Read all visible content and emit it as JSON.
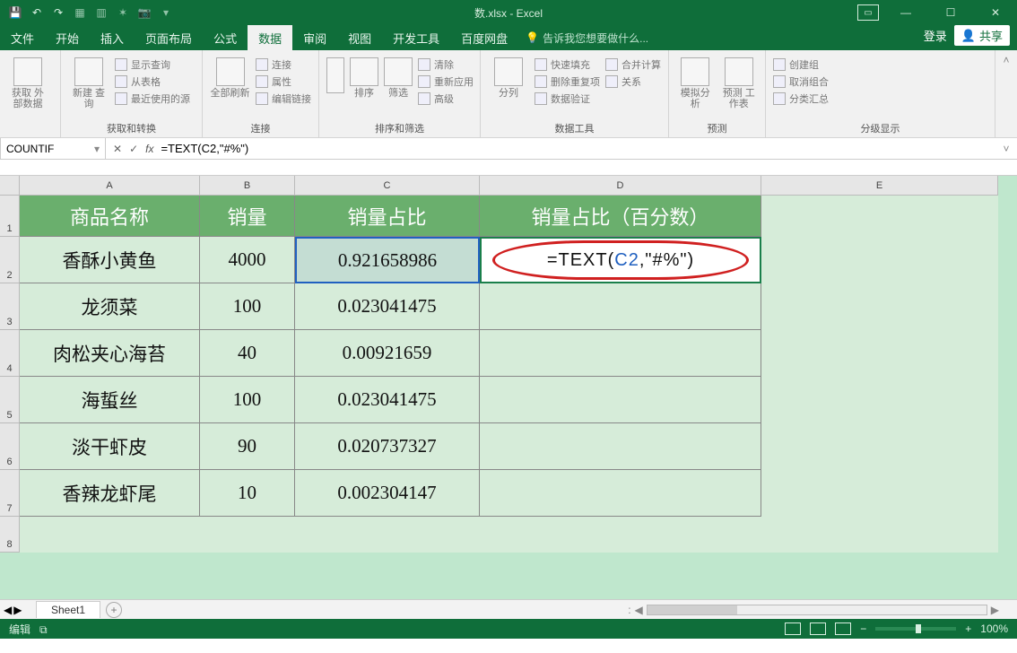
{
  "app": {
    "title": "数.xlsx - Excel"
  },
  "qat": [
    "save-icon",
    "undo-icon",
    "redo-icon",
    "q4",
    "q5",
    "q6",
    "q7"
  ],
  "tabs": {
    "file": "文件",
    "items": [
      "开始",
      "插入",
      "页面布局",
      "公式",
      "数据",
      "审阅",
      "视图",
      "开发工具",
      "百度网盘"
    ],
    "active": "数据",
    "tellme": "告诉我您想要做什么...",
    "login": "登录",
    "share": "共享"
  },
  "ribbon": {
    "g1": {
      "big": "获取\n外部数据",
      "label": ""
    },
    "g2": {
      "big": "新建\n查询",
      "s1": "显示查询",
      "s2": "从表格",
      "s3": "最近使用的源",
      "label": "获取和转换"
    },
    "g3": {
      "big": "全部刷新",
      "s1": "连接",
      "s2": "属性",
      "s3": "编辑链接",
      "label": "连接"
    },
    "g4": {
      "b1": "↓A\nZ",
      "b2": "排序",
      "b3": "筛选",
      "s1": "清除",
      "s2": "重新应用",
      "s3": "高级",
      "label": "排序和筛选"
    },
    "g5": {
      "big": "分列",
      "s1": "快速填充",
      "s2": "删除重复项",
      "s3": "数据验证",
      "s4": "合并计算",
      "s5": "关系",
      "label": "数据工具"
    },
    "g6": {
      "b1": "模拟分析",
      "b2": "预测\n工作表",
      "label": "预测"
    },
    "g7": {
      "s1": "创建组",
      "s2": "取消组合",
      "s3": "分类汇总",
      "label": "分级显示"
    }
  },
  "namebox": {
    "value": "COUNTIF"
  },
  "formulabar": {
    "value": "=TEXT(C2,\"#%\")"
  },
  "columns": {
    "A": "A",
    "B": "B",
    "C": "C",
    "D": "D",
    "E": "E"
  },
  "headers": {
    "A": "商品名称",
    "B": "销量",
    "C": "销量占比",
    "D": "销量占比（百分数）"
  },
  "rows": [
    {
      "A": "香酥小黄鱼",
      "B": "4000",
      "C": "0.921658986"
    },
    {
      "A": "龙须菜",
      "B": "100",
      "C": "0.023041475"
    },
    {
      "A": "肉松夹心海苔",
      "B": "40",
      "C": "0.00921659"
    },
    {
      "A": "海蜇丝",
      "B": "100",
      "C": "0.023041475"
    },
    {
      "A": "淡干虾皮",
      "B": "90",
      "C": "0.020737327"
    },
    {
      "A": "香辣龙虾尾",
      "B": "10",
      "C": "0.002304147"
    }
  ],
  "formula_d2": {
    "pre": "=TEXT(",
    "ref": "C2",
    "post": ",\"#%\")"
  },
  "rownums": [
    "1",
    "2",
    "3",
    "4",
    "5",
    "6",
    "7",
    "8"
  ],
  "sheet": {
    "tab": "Sheet1"
  },
  "status": {
    "left": "编辑",
    "zoom": "100%"
  }
}
